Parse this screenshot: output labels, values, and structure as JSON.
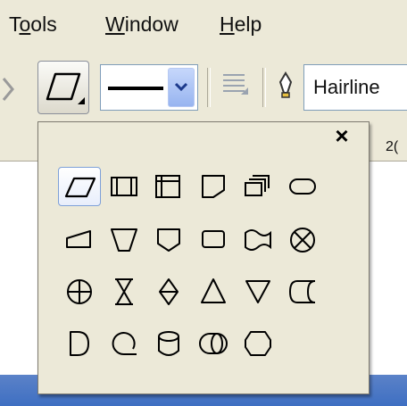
{
  "menubar": {
    "items": [
      {
        "label": "Tools"
      },
      {
        "label": "Window"
      },
      {
        "label": "Help"
      }
    ]
  },
  "toolbar": {
    "shape_tool_icon": "parallelogram-icon",
    "line_style_icon": "line-style-icon",
    "line_weight_value": "Hairline"
  },
  "ruler": {
    "label": "2("
  },
  "palette": {
    "close_label": "×",
    "shapes": [
      [
        "parallelogram",
        "rectangle-sides",
        "rectangle-corners",
        "off-page-reference",
        "stacked-cards",
        "terminator"
      ],
      [
        "manual-input",
        "manual-operation",
        "shield",
        "rounded-rectangle",
        "punched-tape",
        "summing-junction"
      ],
      [
        "or-circle",
        "collate",
        "sort",
        "extract",
        "merge",
        "stored-data"
      ],
      [
        "delay",
        "sequential-storage",
        "disk",
        "direct-access-storage",
        "display"
      ]
    ],
    "selected": "parallelogram"
  },
  "colors": {
    "chrome": "#ece9d8",
    "accent": "#3e6fc2",
    "dropdown": "#97b4f0"
  }
}
